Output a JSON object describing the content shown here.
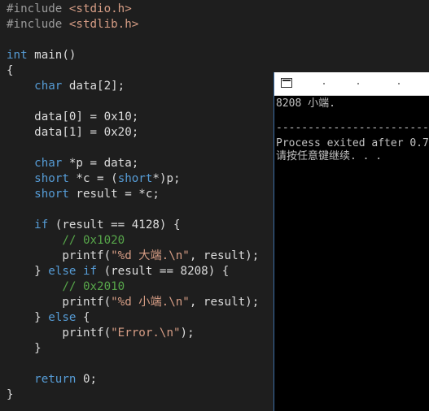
{
  "editor": {
    "lines": [
      [
        {
          "t": "#include ",
          "c": "pp"
        },
        {
          "t": "<stdio.h>",
          "c": "inc"
        }
      ],
      [
        {
          "t": "#include ",
          "c": "pp"
        },
        {
          "t": "<stdlib.h>",
          "c": "inc"
        }
      ],
      [],
      [
        {
          "t": "int",
          "c": "kw"
        },
        {
          "t": " main()",
          "c": "tx"
        }
      ],
      [
        {
          "t": "{",
          "c": "tx"
        }
      ],
      [
        {
          "t": "    ",
          "c": "tx"
        },
        {
          "t": "char",
          "c": "kw"
        },
        {
          "t": " data[2];",
          "c": "tx"
        }
      ],
      [],
      [
        {
          "t": "    data[0] = 0x10;",
          "c": "tx"
        }
      ],
      [
        {
          "t": "    data[1] = 0x20;",
          "c": "tx"
        }
      ],
      [],
      [
        {
          "t": "    ",
          "c": "tx"
        },
        {
          "t": "char",
          "c": "kw"
        },
        {
          "t": " *p = data;",
          "c": "tx"
        }
      ],
      [
        {
          "t": "    ",
          "c": "tx"
        },
        {
          "t": "short",
          "c": "kw"
        },
        {
          "t": " *c = (",
          "c": "tx"
        },
        {
          "t": "short",
          "c": "kw"
        },
        {
          "t": "*)p;",
          "c": "tx"
        }
      ],
      [
        {
          "t": "    ",
          "c": "tx"
        },
        {
          "t": "short",
          "c": "kw"
        },
        {
          "t": " result = *c;",
          "c": "tx"
        }
      ],
      [],
      [
        {
          "t": "    ",
          "c": "tx"
        },
        {
          "t": "if",
          "c": "kw"
        },
        {
          "t": " (result == 4128) {",
          "c": "tx"
        }
      ],
      [
        {
          "t": "        ",
          "c": "tx"
        },
        {
          "t": "// 0x1020",
          "c": "cm"
        }
      ],
      [
        {
          "t": "        printf(",
          "c": "tx"
        },
        {
          "t": "\"%d 大端.\\n\"",
          "c": "str"
        },
        {
          "t": ", result);",
          "c": "tx"
        }
      ],
      [
        {
          "t": "    } ",
          "c": "tx"
        },
        {
          "t": "else",
          "c": "kw"
        },
        {
          "t": " ",
          "c": "tx"
        },
        {
          "t": "if",
          "c": "kw"
        },
        {
          "t": " (result == 8208) {",
          "c": "tx"
        }
      ],
      [
        {
          "t": "        ",
          "c": "tx"
        },
        {
          "t": "// 0x2010",
          "c": "cm"
        }
      ],
      [
        {
          "t": "        printf(",
          "c": "tx"
        },
        {
          "t": "\"%d 小端.\\n\"",
          "c": "str"
        },
        {
          "t": ", result);",
          "c": "tx"
        }
      ],
      [
        {
          "t": "    } ",
          "c": "tx"
        },
        {
          "t": "else",
          "c": "kw"
        },
        {
          "t": " {",
          "c": "tx"
        }
      ],
      [
        {
          "t": "        printf(",
          "c": "tx"
        },
        {
          "t": "\"Error.\\n\"",
          "c": "str"
        },
        {
          "t": ");",
          "c": "tx"
        }
      ],
      [
        {
          "t": "    }",
          "c": "tx"
        }
      ],
      [],
      [
        {
          "t": "    ",
          "c": "tx"
        },
        {
          "t": "return",
          "c": "kw"
        },
        {
          "t": " 0;",
          "c": "tx"
        }
      ],
      [
        {
          "t": "}",
          "c": "tx"
        }
      ]
    ]
  },
  "console": {
    "output_line": "8208 小端.",
    "separator": "--------------------------------",
    "exit_line": "Process exited after 0.7",
    "prompt_line": "请按任意键继续. . ."
  },
  "colors": {
    "editor_bg": "#1e1e1e",
    "keyword": "#569cd6",
    "string": "#d69d85",
    "comment": "#57a64a",
    "console_bg": "#000000",
    "console_text": "#c0c0c0"
  }
}
